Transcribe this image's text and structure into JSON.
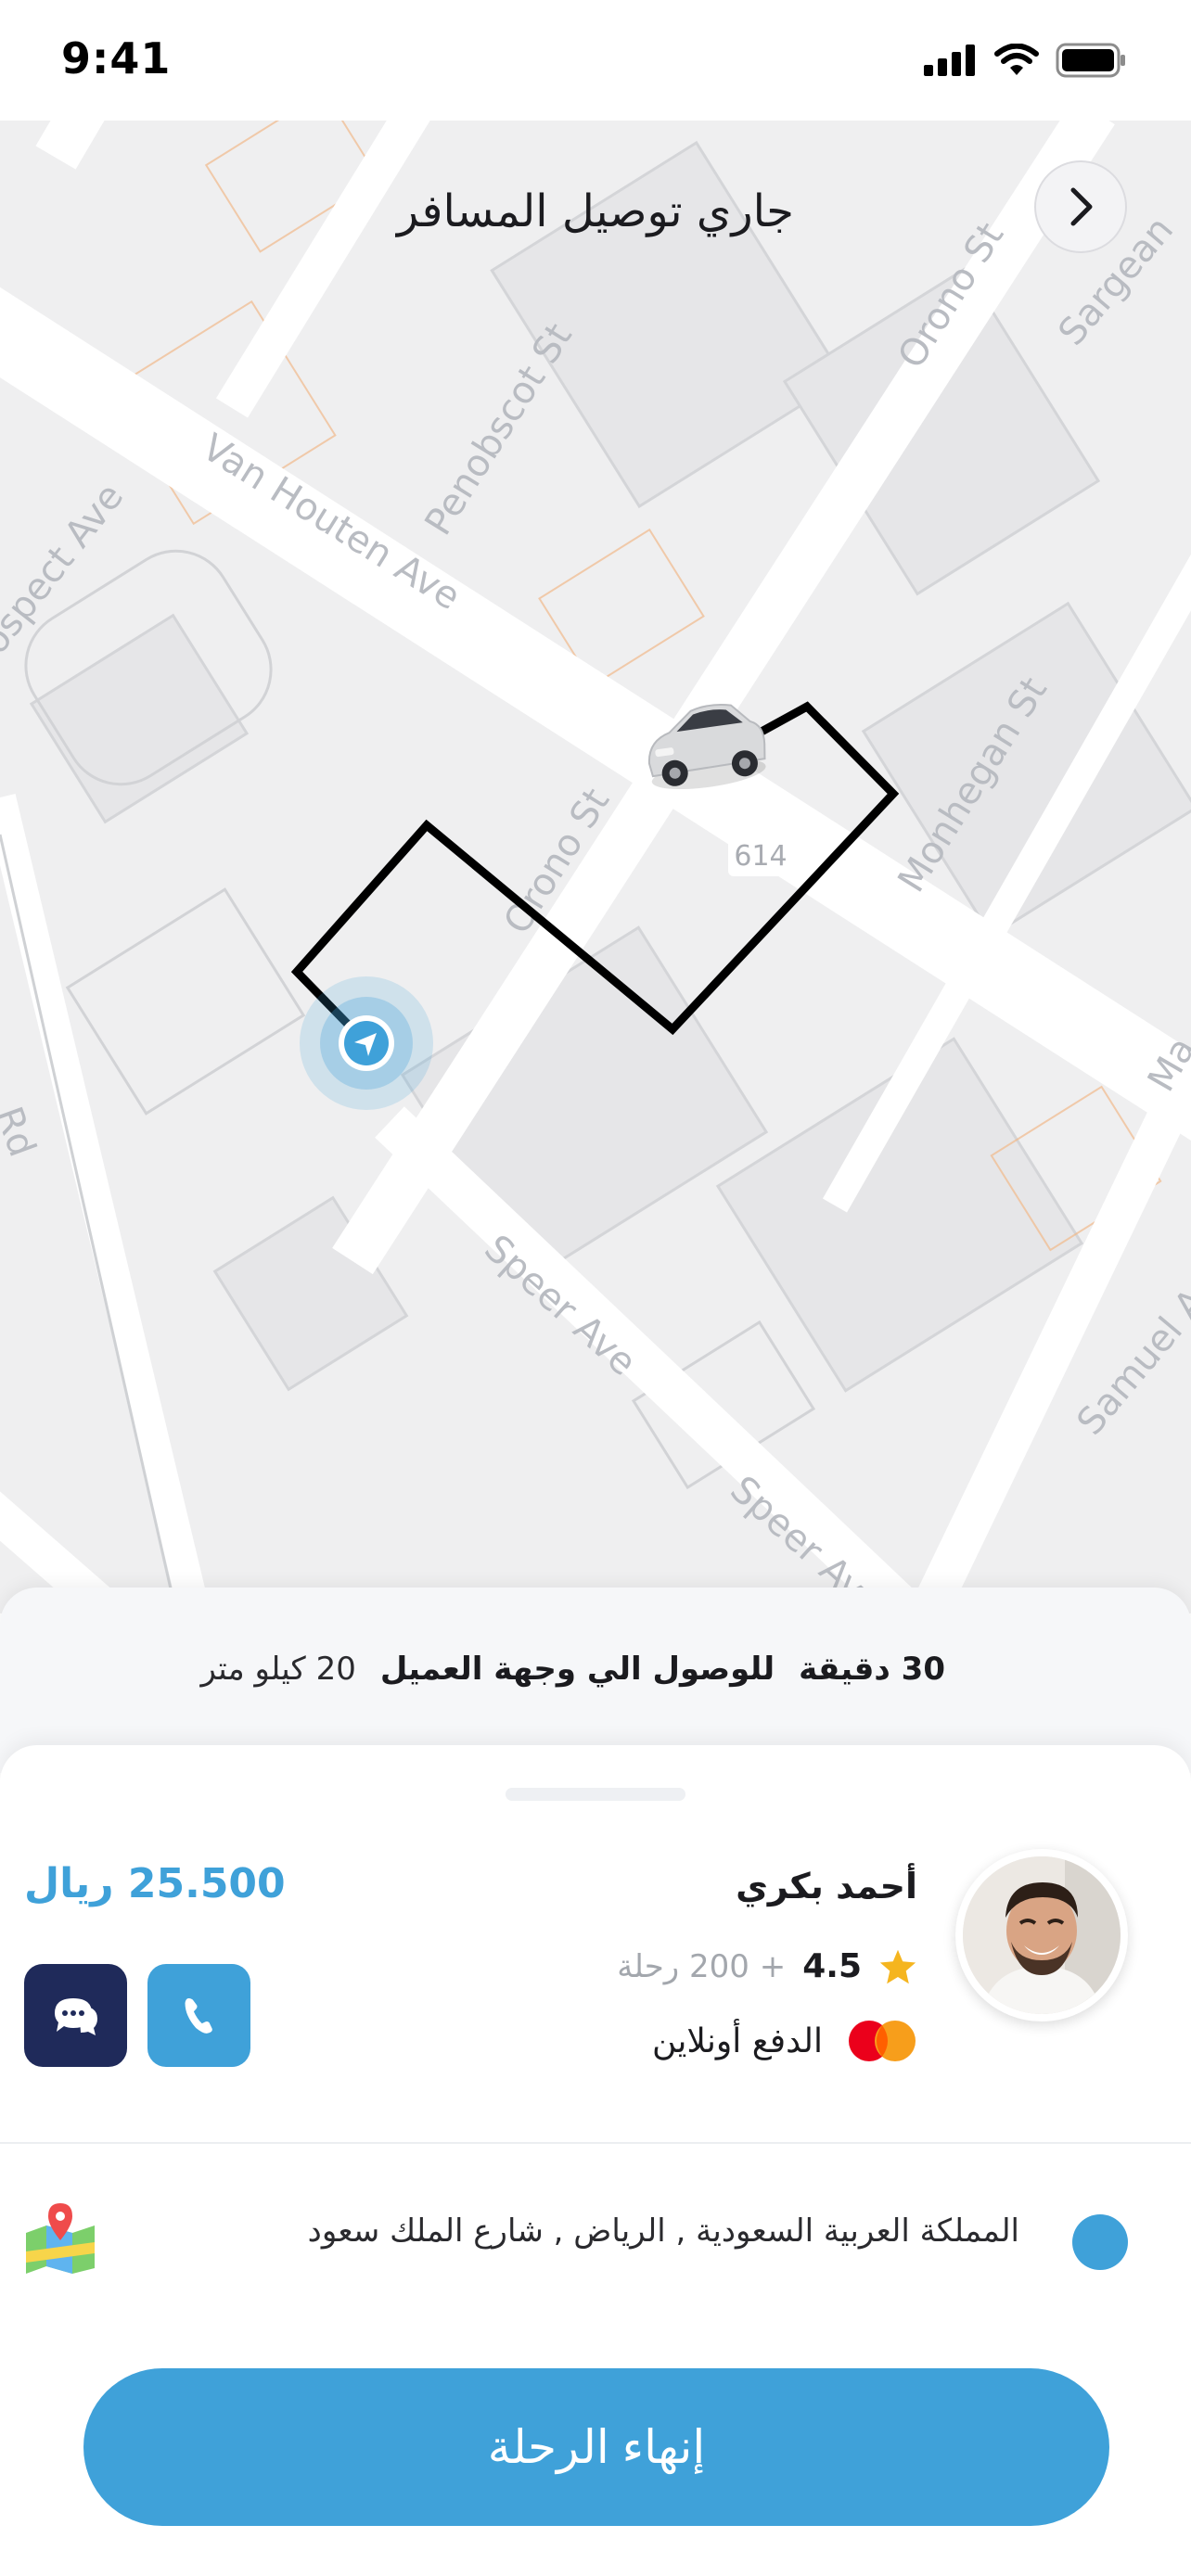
{
  "status_bar": {
    "time": "9:41"
  },
  "header": {
    "title": "جاري توصيل المسافر",
    "back_icon": "chevron-right-icon"
  },
  "map": {
    "street_labels": {
      "van_houten": "Van Houten Ave",
      "prospect": "rospect Ave",
      "penobscot": "Penobscot St",
      "orono_top": "Orono St",
      "orono_mid": "Orono St",
      "monhegan": "Monhegan St",
      "speer_1": "Speer Ave",
      "speer_2": "Speer Av",
      "samuel": "Samuel A",
      "sargeant": "Sargean",
      "rd": "Rd",
      "ma": "Ma"
    },
    "route_badge": "614",
    "colors": {
      "route": "#000000",
      "pin": "#3fa1d9"
    }
  },
  "eta": {
    "minutes": "30 دقيقة",
    "text": "للوصول الي وجهة العميل",
    "distance": "20 كيلو متر"
  },
  "driver": {
    "name": "أحمد بكري",
    "rating": "4.5",
    "trips": "+ 200 رحلة",
    "payment": "الدفع أونلاين",
    "price": "25.500 ريال"
  },
  "address": {
    "text": "المملكة العربية السعودية , الرياض , شارع الملك سعود"
  },
  "actions": {
    "end_trip": "إنهاء الرحلة"
  },
  "theme": {
    "accent": "#3fa1d9",
    "dark": "#1f2a5a"
  }
}
